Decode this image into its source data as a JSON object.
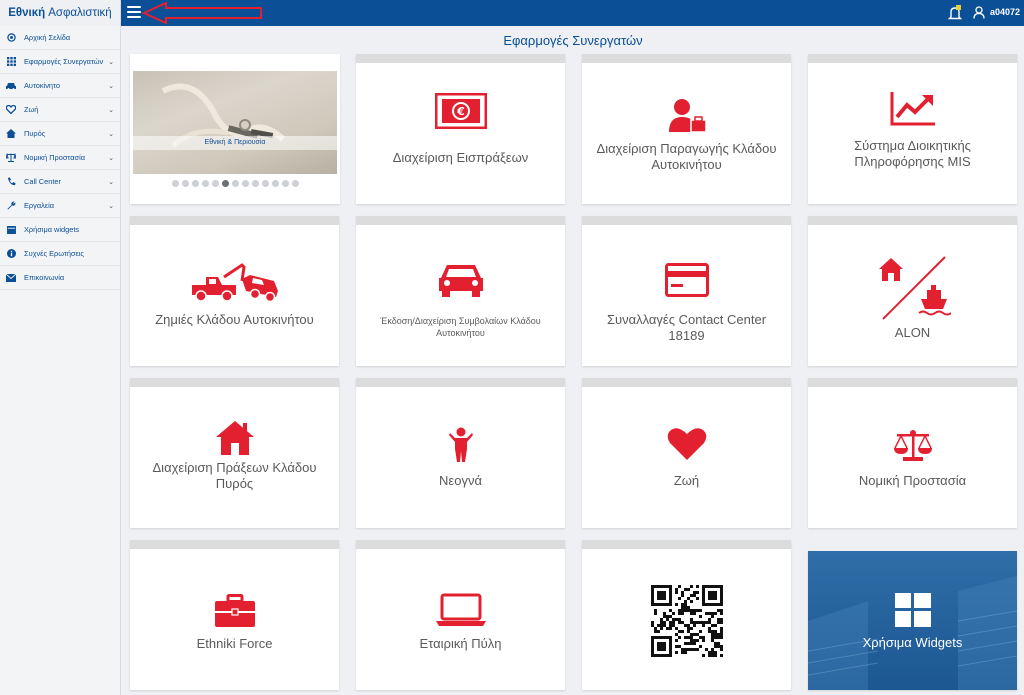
{
  "header": {
    "brand_bold": "Εθνική",
    "brand_rest": "Ασφαλιστική",
    "username": "a04072"
  },
  "sidebar": {
    "items": [
      {
        "label": "Αρχική Σελίδα",
        "icon": "circle-icon",
        "has_chevron": false
      },
      {
        "label": "Εφαρμογές Συνεργατών",
        "icon": "grid-icon",
        "has_chevron": true
      },
      {
        "label": "Αυτοκίνητο",
        "icon": "car-icon",
        "has_chevron": true
      },
      {
        "label": "Ζωή",
        "icon": "heart-icon",
        "has_chevron": true
      },
      {
        "label": "Πυρός",
        "icon": "home-icon",
        "has_chevron": true
      },
      {
        "label": "Νομική Προστασία",
        "icon": "scales-icon",
        "has_chevron": true
      },
      {
        "label": "Call Center",
        "icon": "phone-icon",
        "has_chevron": true
      },
      {
        "label": "Εργαλεία",
        "icon": "wrench-icon",
        "has_chevron": true
      },
      {
        "label": "Χρήσιμα widgets",
        "icon": "widget-icon",
        "has_chevron": false
      },
      {
        "label": "Συχνές Ερωτήσεις",
        "icon": "info-icon",
        "has_chevron": false
      },
      {
        "label": "Επικοινωνία",
        "icon": "envelope-icon",
        "has_chevron": false
      }
    ]
  },
  "main": {
    "title": "Εφαρμογές Συνεργατών",
    "carousel": {
      "caption": "Εθνική & Περιουσία",
      "dot_count": 13,
      "active_dot": 5
    },
    "tiles": [
      {
        "label": "Διαχείριση Εισπράξεων",
        "icon": "banknote-euro-icon"
      },
      {
        "label": "Διαχείριση Παραγωγής Κλάδου Αυτοκινήτου",
        "icon": "agent-briefcase-icon"
      },
      {
        "label": "Σύστημα Διοικητικής Πληροφόρησης MIS",
        "icon": "trend-chart-icon"
      },
      {
        "label": "Ζημιές Κλάδου Αυτοκινήτου",
        "icon": "tow-truck-icon"
      },
      {
        "label": "Έκδοση/Διαχείριση Συμβολαίων Κλάδου Αυτοκινήτου",
        "icon": "car-icon"
      },
      {
        "label": "Συναλλαγές Contact Center 18189",
        "icon": "credit-card-icon"
      },
      {
        "label": "ALON",
        "icon": "house-ship-icon"
      },
      {
        "label": "Διαχείριση Πράξεων Κλάδου Πυρός",
        "icon": "house-icon"
      },
      {
        "label": "Νεογνά",
        "icon": "child-icon"
      },
      {
        "label": "Ζωή",
        "icon": "heart-icon"
      },
      {
        "label": "Νομική Προστασία",
        "icon": "scales-icon"
      },
      {
        "label": "Ethniki Force",
        "icon": "briefcase-icon"
      },
      {
        "label": "Εταιρική Πύλη",
        "icon": "laptop-icon"
      },
      {
        "label": "",
        "icon": "qr-code-icon"
      },
      {
        "label": "Χρήσιμα Widgets",
        "icon": "windows-icon"
      }
    ]
  },
  "colors": {
    "brand_blue": "#0b4f96",
    "accent_red": "#e3202f",
    "tile_header": "#dcdcdc"
  }
}
